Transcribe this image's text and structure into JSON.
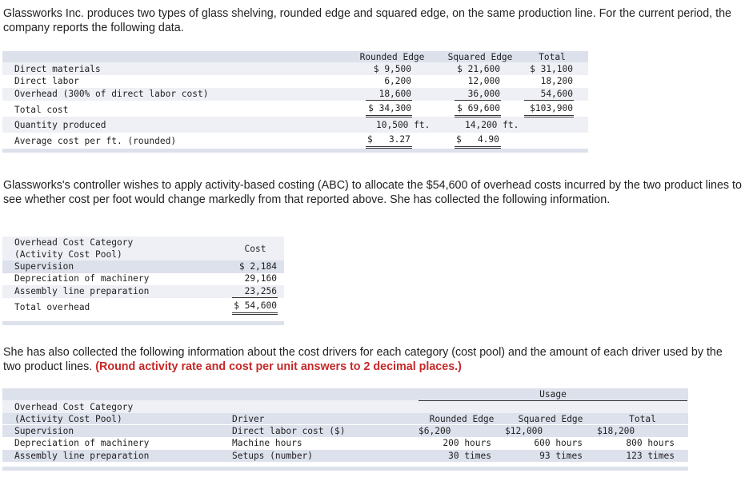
{
  "intro": "Glassworks Inc. produces two types of glass shelving, rounded edge and squared edge, on the same production line. For the current period, the company reports the following data.",
  "table1": {
    "headers": [
      "Rounded Edge",
      "Squared Edge",
      "Total"
    ],
    "rows": [
      {
        "label": "Direct materials",
        "re": "$ 9,500",
        "se": "$ 21,600",
        "tot": "$ 31,100"
      },
      {
        "label": "Direct labor",
        "re": "6,200",
        "se": "12,000",
        "tot": "18,200"
      },
      {
        "label": "Overhead (300% of direct labor cost)",
        "re": "18,600",
        "se": "36,000",
        "tot": "54,600"
      },
      {
        "label": "Total cost",
        "re": "$ 34,300",
        "se": "$ 69,600",
        "tot": "$103,900"
      },
      {
        "label": "Quantity produced",
        "re": "10,500 ft.",
        "se": "14,200 ft.",
        "tot": ""
      },
      {
        "label": "Average cost per ft. (rounded)",
        "re": "$   3.27",
        "se": "$   4.90",
        "tot": ""
      }
    ]
  },
  "para2": "Glassworks's controller wishes to apply activity-based costing (ABC) to allocate the $54,600 of overhead costs incurred by the two product lines to see whether cost per foot would change markedly from that reported above. She has collected the following information.",
  "table2": {
    "header_line1": "Overhead Cost Category",
    "header_line2": "(Activity Cost Pool)",
    "cost_header": "Cost",
    "rows": [
      {
        "label": "Supervision",
        "cost": "$ 2,184"
      },
      {
        "label": "Depreciation of machinery",
        "cost": "29,160"
      },
      {
        "label": "Assembly line preparation",
        "cost": "23,256"
      },
      {
        "label": "Total overhead",
        "cost": "$ 54,600"
      }
    ]
  },
  "para3_main": "She has also collected the following information about the cost drivers for each category (cost pool) and the amount of each driver used by the two product lines.",
  "para3_bold": "(Round activity rate and cost per unit answers to 2 decimal places.)",
  "table3": {
    "usage_header": "Usage",
    "header_line1": "Overhead Cost Category",
    "header_line2": "(Activity Cost Pool)",
    "driver_header": "Driver",
    "col_headers": [
      "Rounded Edge",
      "Squared Edge",
      "Total"
    ],
    "rows": [
      {
        "label": "Supervision",
        "driver": "Direct labor cost ($)",
        "re": "$6,200",
        "se": "$12,000",
        "tot": "$18,200"
      },
      {
        "label": "Depreciation of machinery",
        "driver": "Machine hours",
        "re": "200 hours",
        "se": "600 hours",
        "tot": "800 hours"
      },
      {
        "label": "Assembly line preparation",
        "driver": "Setups (number)",
        "re": "30 times",
        "se": "93 times",
        "tot": "123 times"
      }
    ]
  }
}
